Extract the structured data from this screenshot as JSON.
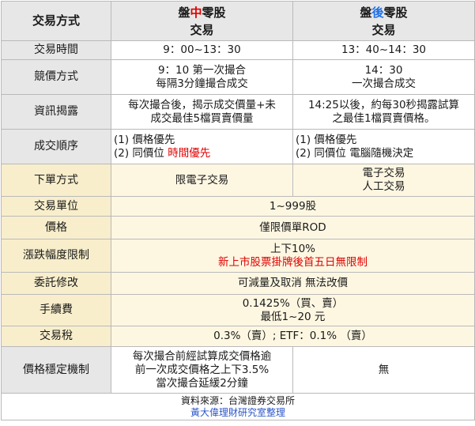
{
  "header": {
    "corner_label": "交易方式",
    "col_intraday": {
      "prefix": "盤",
      "accent": "中",
      "suffix": "零股",
      "line2": "交易"
    },
    "col_afterhours": {
      "prefix": "盤",
      "accent": "後",
      "suffix": "零股",
      "line2": "交易"
    }
  },
  "rows": {
    "trading_hours": {
      "label": "交易時間",
      "intraday": "9：00~13：30",
      "afterhours": "13：40~14：30"
    },
    "matching_method": {
      "label": "競價方式",
      "intraday": [
        "9：10 第一次撮合",
        "每隔3分鐘撮合成交"
      ],
      "afterhours": [
        "14：30",
        "一次撮合成交"
      ]
    },
    "info_disclosure": {
      "label": "資訊揭露",
      "intraday": [
        "每次撮合後，揭示成交價量+未",
        "成交最佳5檔買賣價量"
      ],
      "afterhours": [
        "14:25以後，約每30秒揭露試算",
        "之最佳1檔買賣價格。"
      ]
    },
    "matching_order": {
      "label": "成交順序",
      "intraday": {
        "line1": "(1) 價格優先",
        "line2_prefix": "(2) 同價位 ",
        "line2_highlight": "時間優先"
      },
      "afterhours": {
        "line1": "(1) 價格優先",
        "line2": "(2) 同價位 電腦隨機決定"
      }
    },
    "order_method": {
      "label": "下單方式",
      "intraday": "限電子交易",
      "afterhours": [
        "電子交易",
        "人工交易"
      ]
    },
    "trading_unit": {
      "label": "交易單位",
      "value": "1~999股"
    },
    "price": {
      "label": "價格",
      "value": "僅限價單ROD"
    },
    "price_limit": {
      "label": "漲跌幅度限制",
      "value": "上下10%",
      "note": "新上市股票掛牌後首五日無限制"
    },
    "order_modify": {
      "label": "委託修改",
      "value": "可減量及取消 無法改價"
    },
    "fee": {
      "label": "手續費",
      "value": [
        "0.1425%（買、賣）",
        "最低1~20 元"
      ]
    },
    "tax": {
      "label": "交易稅",
      "value": "0.3%（賣）; ETF：0.1% （賣）"
    },
    "stabilization": {
      "label": "價格穩定機制",
      "intraday": [
        "每次撮合前經試算成交價格逾",
        "前一次成交價格之上下3.5%",
        "當次撮合延緩2分鐘"
      ],
      "afterhours": "無"
    }
  },
  "source": {
    "line1": "資料來源：台灣證券交易所",
    "line2": "黃大偉理財研究室整理"
  },
  "colors": {
    "header_bg": "#e7e7e7",
    "cream_bg": "#fdf7e2",
    "red": "#e00000",
    "blue": "#1e6fe6",
    "brand_blue": "#2a55c8"
  }
}
